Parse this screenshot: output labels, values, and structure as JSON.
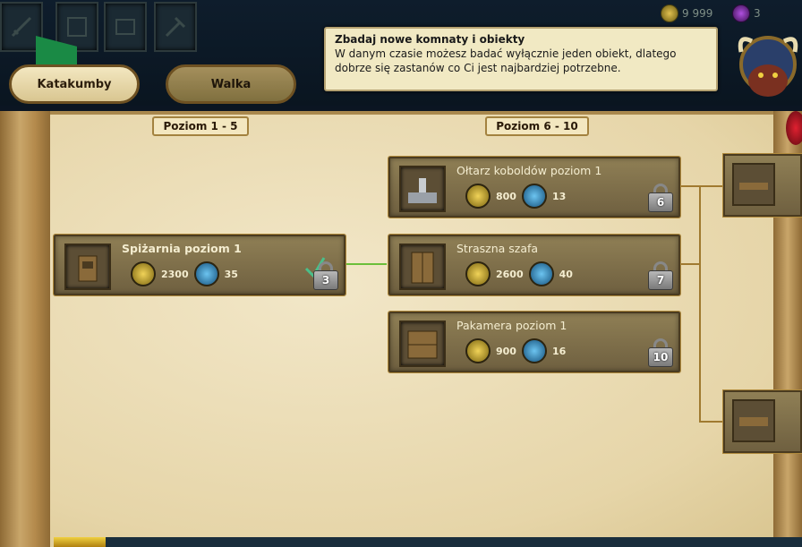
{
  "tabs": {
    "active": "Katakumby",
    "inactive": "Walka"
  },
  "currency": {
    "gold": "9 999",
    "gems": "3"
  },
  "tooltip": {
    "title": "Zbadaj nowe komnaty i obiekty",
    "line1": "W danym czasie możesz badać wyłącznie jeden obiekt, dlatego",
    "line2": "dobrze się zastanów co Ci jest najbardziej potrzebne."
  },
  "levels": {
    "range1": "Poziom 1 - 5",
    "range2": "Poziom 6 - 10"
  },
  "nodes": [
    {
      "name": "Spiżarnia poziom 1",
      "gold": "2300",
      "blue": "35",
      "level": "3"
    },
    {
      "name": "Ołtarz koboldów poziom 1",
      "gold": "800",
      "blue": "13",
      "level": "6"
    },
    {
      "name": "Straszna szafa",
      "gold": "2600",
      "blue": "40",
      "level": "7"
    },
    {
      "name": "Pakamera poziom 1",
      "gold": "900",
      "blue": "16",
      "level": "10"
    }
  ],
  "colors": {
    "parchment": "#efe3c2",
    "node": "#7f7049",
    "accent": "#a07a30"
  },
  "icons": [
    "sword-icon",
    "shield-icon",
    "banner-icon",
    "gold-coin-icon",
    "blue-gem-icon",
    "lock-icon",
    "checkmark-icon",
    "demon-avatar-icon"
  ]
}
